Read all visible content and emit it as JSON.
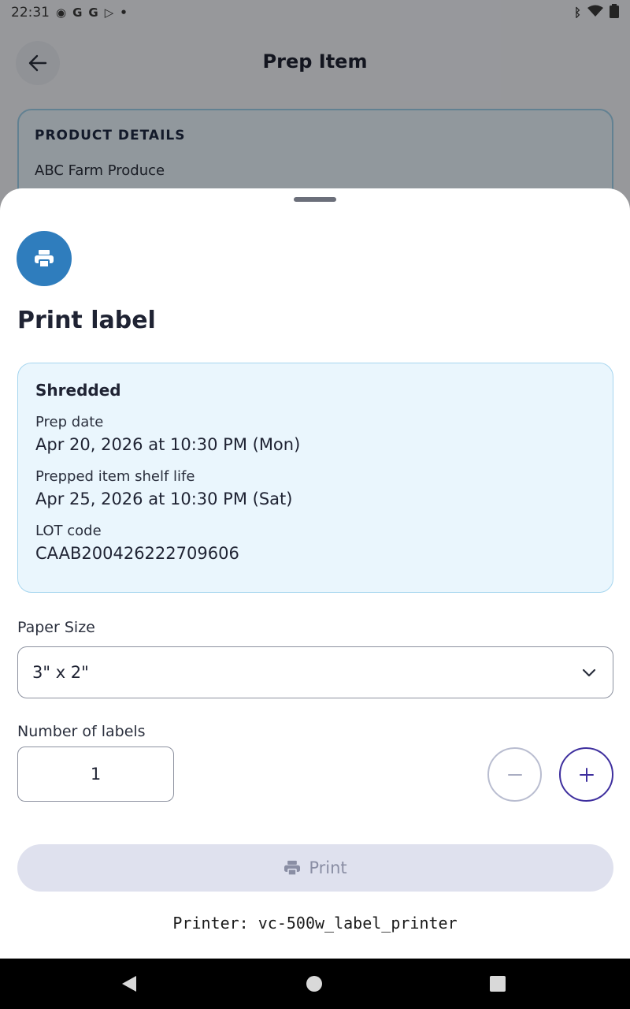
{
  "status_bar": {
    "time": "22:31",
    "left_icons": [
      "record-icon",
      "google-icon",
      "google-icon",
      "play-store-icon",
      "dot-icon"
    ],
    "right_icons": [
      "bluetooth-icon",
      "wifi-icon",
      "battery-icon"
    ]
  },
  "background": {
    "title": "Prep Item",
    "details_title": "PRODUCT DETAILS",
    "details_line": "ABC Farm Produce"
  },
  "sheet": {
    "title": "Print label",
    "info": {
      "heading": "Shredded",
      "prep_date_label": "Prep date",
      "prep_date_value": "Apr 20, 2026 at 10:30 PM (Mon)",
      "shelf_life_label": "Prepped item shelf life",
      "shelf_life_value": "Apr 25, 2026 at 10:30 PM (Sat)",
      "lot_label": "LOT code",
      "lot_value": "CAAB200426222709606"
    },
    "paper_size_label": "Paper Size",
    "paper_size_value": "3\" x 2\"",
    "num_labels_label": "Number of labels",
    "num_labels_value": "1",
    "print_button": "Print",
    "printer_text": "Printer: vc-500w_label_printer"
  },
  "colors": {
    "accent_blue": "#2f7dbd",
    "info_bg": "#eaf6fd",
    "plus_border": "#3e2f9e",
    "disabled_btn": "#dfe1ee"
  }
}
